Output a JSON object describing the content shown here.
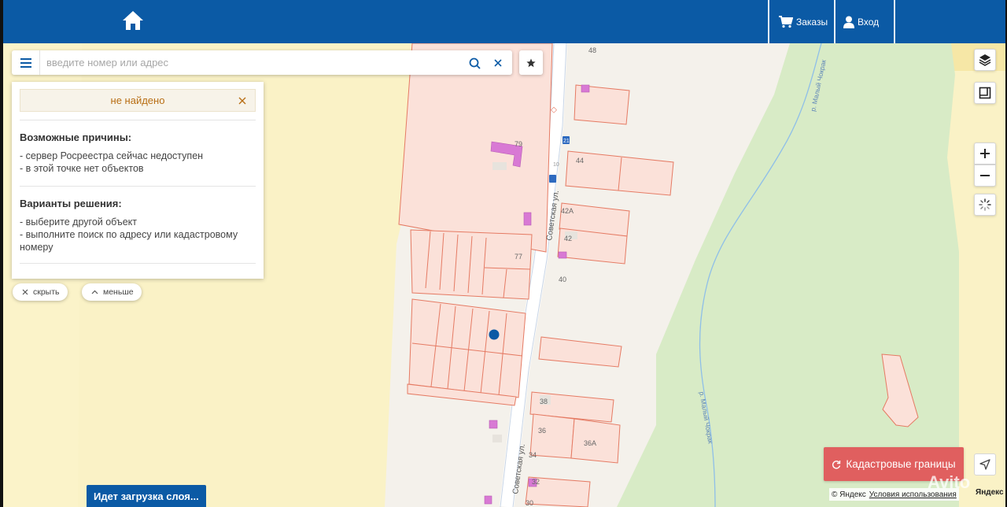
{
  "header": {
    "orders_label": "Заказы",
    "login_label": "Вход"
  },
  "search": {
    "placeholder": "введите номер или адрес"
  },
  "info_panel": {
    "not_found": "не найдено",
    "reasons_title": "Возможные причины:",
    "reasons": [
      "- сервер Росреестра сейчас недоступен",
      "- в этой точке нет объектов"
    ],
    "solutions_title": "Варианты решения:",
    "solutions": [
      "- выберите другой объект",
      "- выполните поиск по адресу или кадастровому номеру"
    ],
    "hide_label": "скрыть",
    "less_label": "меньше"
  },
  "map_labels": {
    "street": "Советская ул.",
    "street_bottom": "Советская ул.",
    "river_top": "р. Малый Чокрак",
    "river_bottom": "р. Малый Чокрак",
    "house_numbers": [
      "48",
      "79",
      "44",
      "42А",
      "42",
      "77",
      "40",
      "38",
      "36",
      "36А",
      "34",
      "32",
      "30",
      "21",
      "10"
    ]
  },
  "cadastral_button_label": "Кадастровые границы",
  "loading_label": "Идет загрузка слоя...",
  "copyright": {
    "yandex": "© Яндекс",
    "terms": "Условия использования",
    "logo": "Яндекс"
  },
  "watermark": "Avito",
  "colors": {
    "header": "#0b5aa5",
    "parcel_fill": "#fbe1d9",
    "parcel_stroke": "#e57a63",
    "building": "#d86bd4",
    "green": "#d9ecc6",
    "yellow": "#f9f1c2",
    "road": "#ffffff",
    "cadastral_button": "#e05f5f",
    "marker": "#0b5aa5"
  },
  "icons": {
    "home": "home-icon",
    "orders": "cart-icon",
    "login": "user-icon",
    "menu": "menu-icon",
    "search": "search-icon",
    "clear": "close-icon",
    "favorite": "star-icon",
    "layers": "layers-icon",
    "ruler": "ruler-icon",
    "zoom_in": "plus-icon",
    "zoom_out": "minus-icon",
    "rosreestr": "loading-icon",
    "refresh": "refresh-icon",
    "locate": "navigation-arrow-icon"
  }
}
